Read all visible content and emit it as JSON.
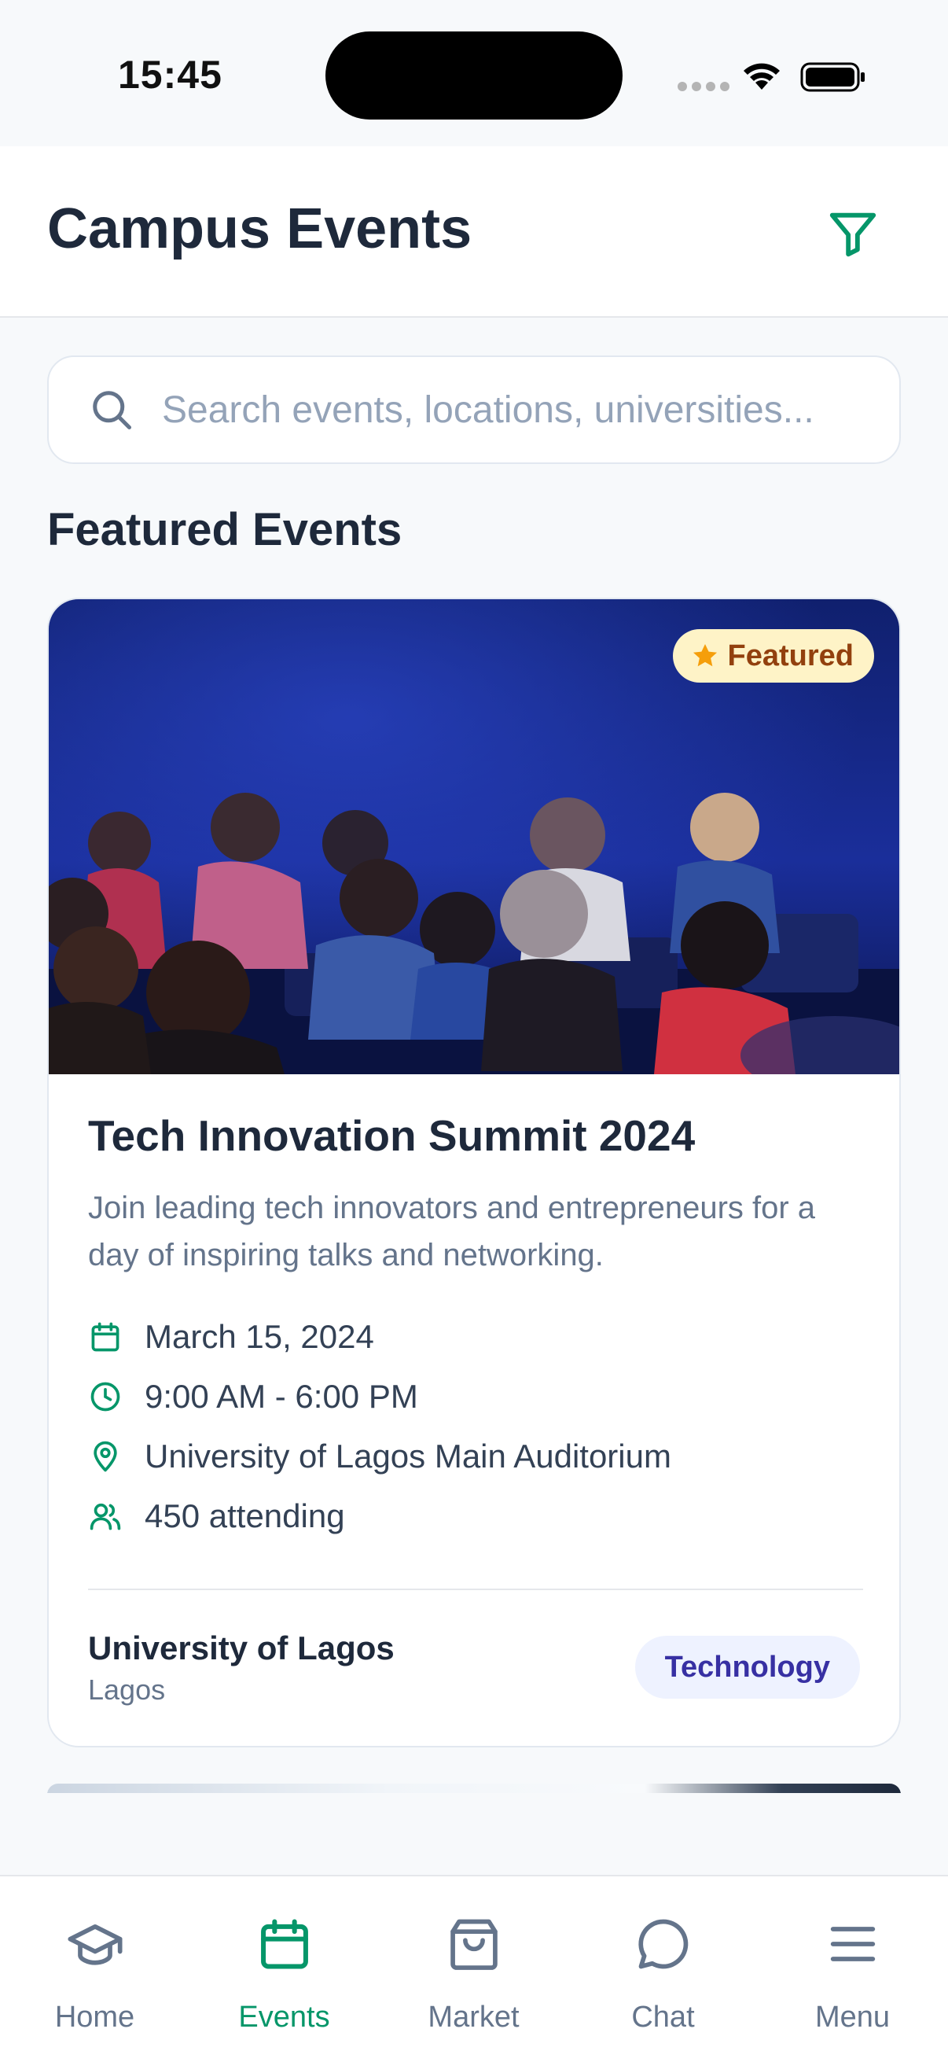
{
  "status_bar": {
    "time": "15:45"
  },
  "header": {
    "title": "Campus Events"
  },
  "search": {
    "placeholder": "Search events, locations, universities..."
  },
  "section": {
    "title": "Featured Events"
  },
  "event": {
    "badge": "Featured",
    "title": "Tech Innovation Summit 2024",
    "description": "Join leading tech innovators and entrepreneurs for a day of inspiring talks and networking.",
    "date": "March 15, 2024",
    "time": "9:00 AM - 6:00 PM",
    "location": "University of Lagos Main Auditorium",
    "attendance": "450 attending",
    "university": "University of Lagos",
    "city": "Lagos",
    "category": "Technology"
  },
  "nav": {
    "items": [
      {
        "label": "Home",
        "icon": "graduation-cap-icon"
      },
      {
        "label": "Events",
        "icon": "calendar-icon",
        "active": true
      },
      {
        "label": "Market",
        "icon": "shopping-bag-icon"
      },
      {
        "label": "Chat",
        "icon": "chat-bubble-icon"
      },
      {
        "label": "Menu",
        "icon": "menu-icon"
      }
    ]
  },
  "colors": {
    "accent": "#059669",
    "badge_bg": "#fef3c7",
    "badge_text": "#92400e",
    "tag_bg": "#eef2ff",
    "tag_text": "#3730a3"
  }
}
